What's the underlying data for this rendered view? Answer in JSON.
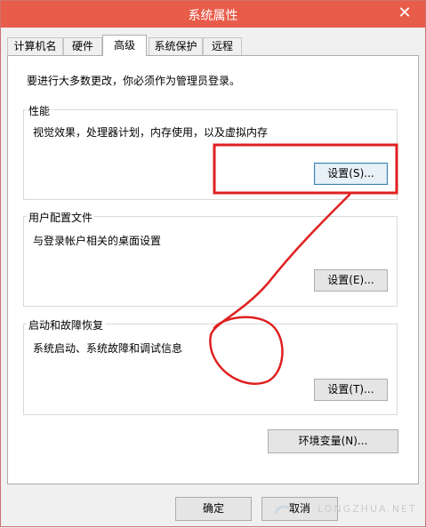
{
  "window": {
    "title": "系统属性",
    "close_glyph": "✕"
  },
  "tabs": [
    {
      "label": "计算机名",
      "active": false
    },
    {
      "label": "硬件",
      "active": false
    },
    {
      "label": "高级",
      "active": true
    },
    {
      "label": "系统保护",
      "active": false
    },
    {
      "label": "远程",
      "active": false
    }
  ],
  "admin_notice": "要进行大多数更改，你必须作为管理员登录。",
  "performance": {
    "title": "性能",
    "description": "视觉效果，处理器计划，内存使用，以及虚拟内存",
    "button": "设置(S)..."
  },
  "user_profiles": {
    "title": "用户配置文件",
    "description": "与登录帐户相关的桌面设置",
    "button": "设置(E)..."
  },
  "startup_recovery": {
    "title": "启动和故障恢复",
    "description": "系统启动、系统故障和调试信息",
    "button": "设置(T)..."
  },
  "env_button": "环境变量(N)...",
  "footer": {
    "ok": "确定",
    "cancel": "取消"
  },
  "annotation": {
    "color": "#e02020"
  },
  "colors": {
    "titlebar": "#e85c4a",
    "focus_border": "#3c7fb1"
  }
}
